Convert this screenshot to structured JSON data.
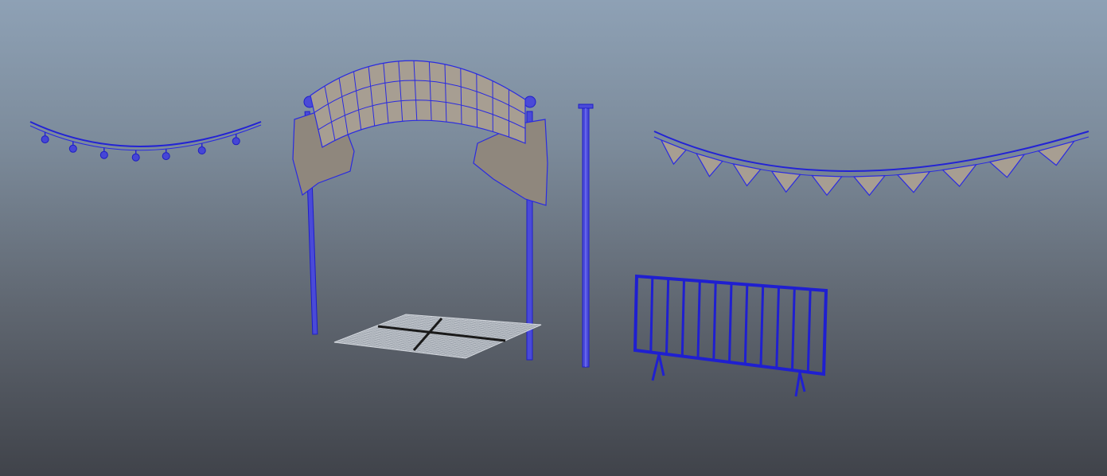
{
  "viewport": {
    "background_top": "#8ea1b5",
    "background_bottom": "#40434a",
    "wireframe_color": "#2a2ae0",
    "shaded_color": "#a79e92"
  },
  "objects": [
    {
      "name": "light-string"
    },
    {
      "name": "banner-arch"
    },
    {
      "name": "ground-tile"
    },
    {
      "name": "lamp-pole"
    },
    {
      "name": "bunting-flags"
    },
    {
      "name": "crowd-barrier"
    }
  ],
  "axis_indicator": {
    "x_color": "#22dd22"
  }
}
